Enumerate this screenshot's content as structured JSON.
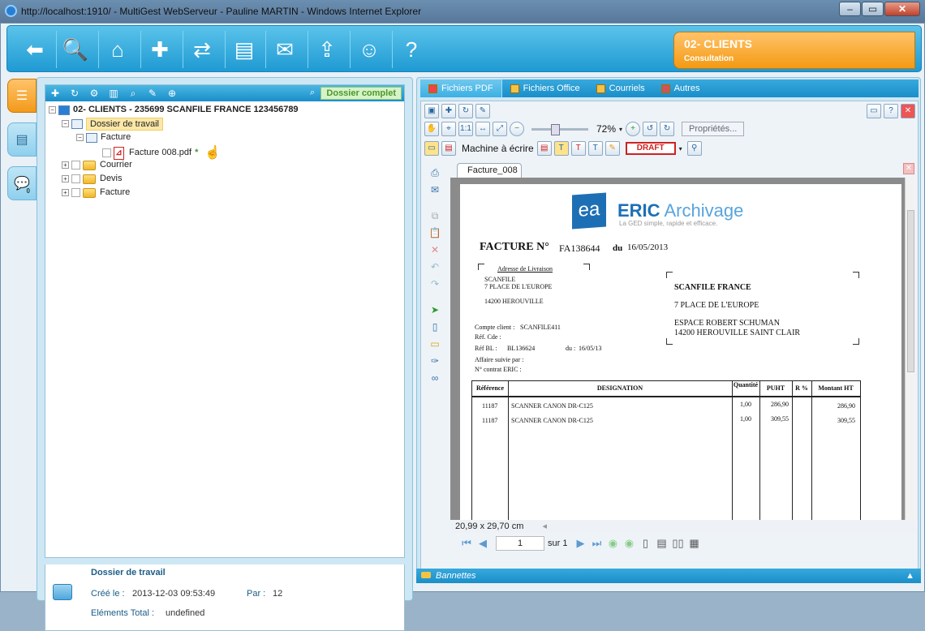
{
  "window": {
    "title": "http://localhost:1910/ - MultiGest WebServeur - Pauline MARTIN - Windows Internet Explorer"
  },
  "section": {
    "name": "02- CLIENTS",
    "mode": "Consultation"
  },
  "tree": {
    "dossier_complet": "Dossier complet",
    "root": "02- CLIENTS - 235699 SCANFILE FRANCE 123456789",
    "dossier_travail": "Dossier de travail",
    "sub_facture": "Facture",
    "file": "Facture  008.pdf",
    "file_mark": "*",
    "courrier": "Courrier",
    "devis": "Devis",
    "facture": "Facture"
  },
  "info": {
    "title": "Dossier de travail",
    "created_label": "Créé le :",
    "created_value": "2013-12-03 09:53:49",
    "par_label": "Par :",
    "par_value": "12",
    "total_label": "Eléments Total :",
    "total_value": "undefined"
  },
  "sidetabs": {
    "comments_count": "0"
  },
  "right_tabs": [
    "Fichiers PDF",
    "Fichiers Office",
    "Courriels",
    "Autres"
  ],
  "viewer": {
    "zoom": "72%",
    "properties": "Propriétés...",
    "typewriter": "Machine à écrire",
    "stamp": "DRAFT",
    "doc_tab": "Facture_008",
    "page_size": "20,99 x 29,70 cm",
    "page_current": "1",
    "page_of": "sur 1"
  },
  "invoice": {
    "logo_mark": "ea",
    "logo_brand": "ERIC",
    "logo_suffix": "Archivage",
    "logo_tagline": "La GED simple, rapide et efficace.",
    "title": "FACTURE  N°",
    "number": "FA138644",
    "du": "du",
    "date": "16/05/2013",
    "delivery_label": "Adresse de Livraison",
    "delivery_lines": [
      "SCANFILE",
      "7 PLACE DE L'EUROPE",
      "14200 HEROUVILLE"
    ],
    "client_name": "SCANFILE FRANCE",
    "client_lines": [
      "7 PLACE DE L'EUROPE",
      "ESPACE ROBERT SCHUMAN",
      "14200 HEROUVILLE SAINT CLAIR"
    ],
    "compte_label": "Compte client :",
    "compte_value": "SCANFILE411",
    "ref_cde": "Réf. Cde :",
    "ref_bl_label": "Réf BL     :",
    "ref_bl_value": "BL136624",
    "bl_du": "du :",
    "bl_date": "16/05/13",
    "affaire": "Affaire suivie par :",
    "contrat": "N° contrat ERIC :",
    "headers": [
      "Référence",
      "DESIGNATION",
      "Quantité",
      "PUHT",
      "R %",
      "Montant HT"
    ],
    "rows": [
      {
        "ref": "11187",
        "designation": "SCANNER CANON DR-C125",
        "qty": "1,00",
        "puht": "286,90",
        "montant": "286,90"
      },
      {
        "ref": "11187",
        "designation": "SCANNER CANON DR-C125",
        "qty": "1,00",
        "puht": "309,55",
        "montant": "309,55"
      }
    ]
  },
  "footer": {
    "bannettes": "Bannettes"
  }
}
